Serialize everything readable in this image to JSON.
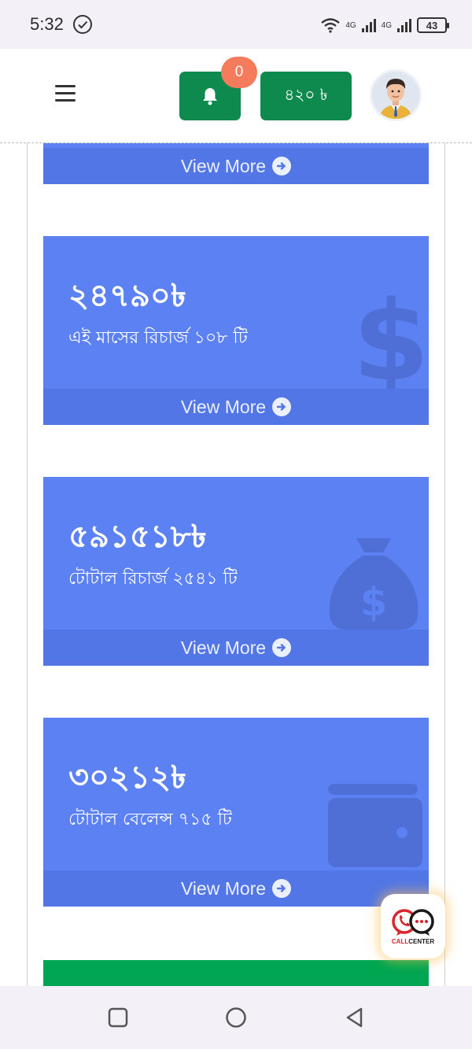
{
  "status_bar": {
    "time": "5:32",
    "network_1": "4G",
    "network_2": "4G",
    "battery": "43"
  },
  "header": {
    "notification_count": "0",
    "balance": "৪২০ ৳",
    "colors": {
      "button_green": "#0e8a4f",
      "badge": "#f47b5b"
    }
  },
  "cards": [
    {
      "view_more": "View More"
    },
    {
      "value": "২৪৭৯০৳",
      "label": "এই মাসের রিচার্জ ১০৮ টি",
      "icon": "dollar-sign-icon",
      "view_more": "View More"
    },
    {
      "value": "৫৯১৫১৮৳",
      "label": "টোটাল রিচার্জ ২৫৪১ টি",
      "icon": "money-bag-icon",
      "view_more": "View More"
    },
    {
      "value": "৩০২১২৳",
      "label": "টোটাল বেলেন্স ৭১৫ টি",
      "icon": "wallet-icon",
      "view_more": "View More"
    }
  ],
  "card_colors": {
    "card_bg": "#5b81f2",
    "footer_bg": "#5276e5",
    "next_card": "#00a651"
  },
  "callcenter": {
    "label_red": "CALL",
    "label_dark": "CENTER"
  }
}
